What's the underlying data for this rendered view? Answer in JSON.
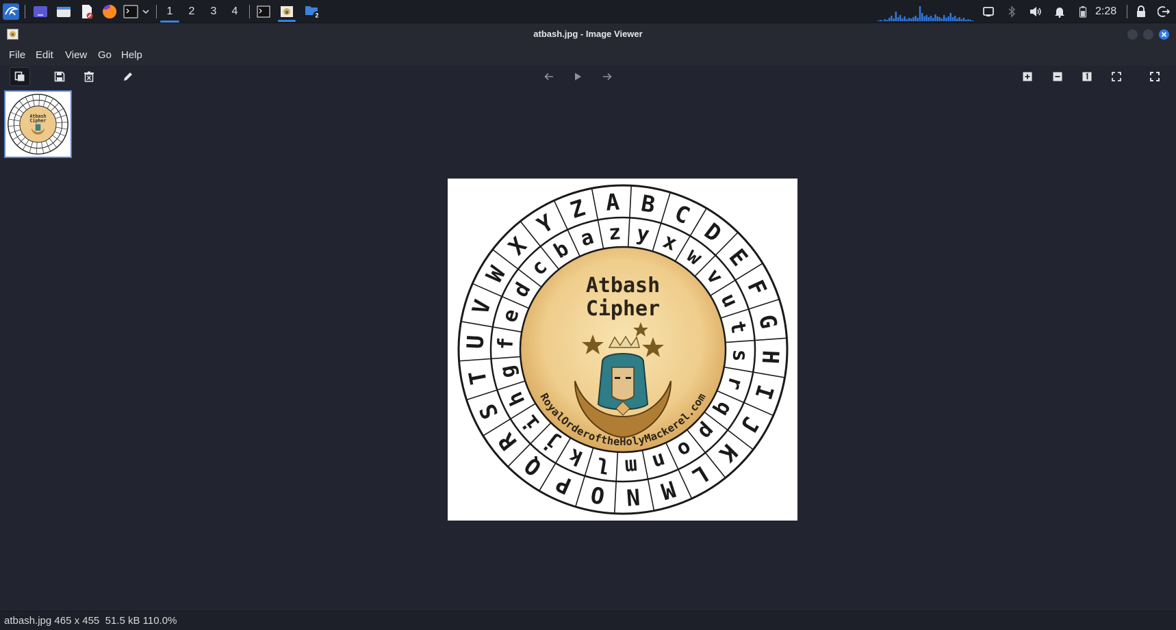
{
  "panel": {
    "workspaces": [
      "1",
      "2",
      "3",
      "4"
    ],
    "active_workspace": "1",
    "folder_badge": "2",
    "clock": "2:28",
    "accent": "#3b82e0",
    "icons": [
      "kali-menu-icon",
      "desktop-icon",
      "file-manager-icon",
      "text-editor-icon",
      "firefox-icon",
      "terminal-icon",
      "chevron-down-icon",
      "terminal-window-icon",
      "image-viewer-task-icon",
      "folder-icon",
      "cpu-graph-icon",
      "screen-icon",
      "bluetooth-icon",
      "volume-icon",
      "bell-icon",
      "battery-icon",
      "lock-icon",
      "logout-icon"
    ]
  },
  "window": {
    "title": "atbash.jpg - Image Viewer"
  },
  "menubar": {
    "items": [
      "File",
      "Edit",
      "View",
      "Go",
      "Help"
    ]
  },
  "toolbar": {
    "icons": [
      "thumbnail-bar-icon",
      "save-icon",
      "delete-icon",
      "edit-icon",
      "back-icon",
      "play-icon",
      "forward-icon",
      "zoom-in-icon",
      "zoom-out-icon",
      "zoom-100-icon",
      "zoom-fit-icon",
      "fullscreen-icon"
    ]
  },
  "image": {
    "outer_ring": [
      "A",
      "B",
      "C",
      "D",
      "E",
      "F",
      "G",
      "H",
      "I",
      "J",
      "K",
      "L",
      "M",
      "N",
      "O",
      "P",
      "Q",
      "R",
      "S",
      "T",
      "U",
      "V",
      "W",
      "X",
      "Y",
      "Z"
    ],
    "inner_ring": [
      "z",
      "y",
      "x",
      "w",
      "v",
      "u",
      "t",
      "s",
      "r",
      "q",
      "p",
      "o",
      "n",
      "m",
      "l",
      "k",
      "j",
      "i",
      "h",
      "g",
      "f",
      "e",
      "d",
      "c",
      "b",
      "a"
    ],
    "title_line1": "Atbash",
    "title_line2": "Cipher",
    "arc_text": "RoyalOrderoftheHolyMackerel.com"
  },
  "status": {
    "text": "atbash.jpg 465 x 455  51.5 kB 110.0%"
  }
}
